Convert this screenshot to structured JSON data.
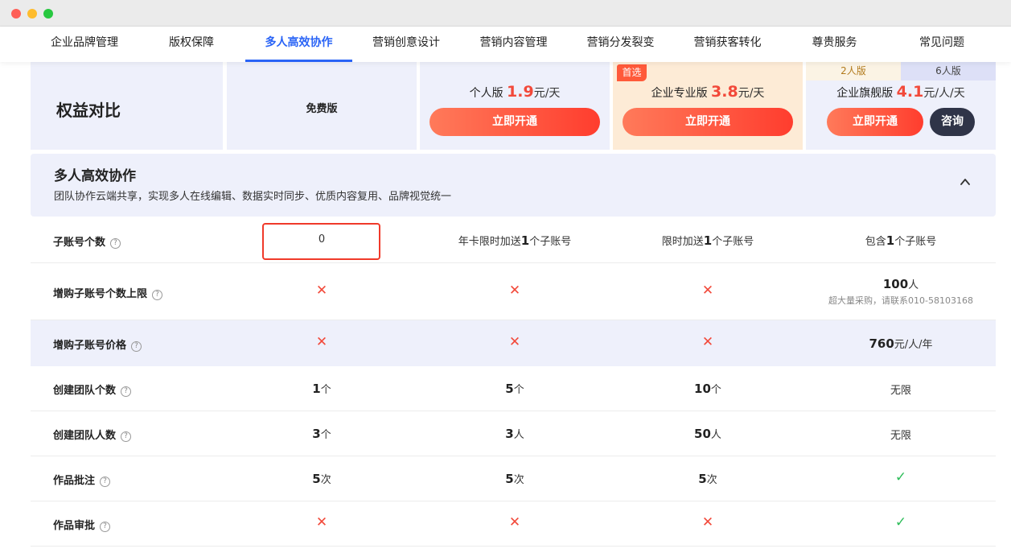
{
  "nav": {
    "tabs": [
      {
        "label": "企业品牌管理"
      },
      {
        "label": "版权保障"
      },
      {
        "label": "多人高效协作"
      },
      {
        "label": "营销创意设计"
      },
      {
        "label": "营销内容管理"
      },
      {
        "label": "营销分发裂变"
      },
      {
        "label": "营销获客转化"
      },
      {
        "label": "尊贵服务"
      },
      {
        "label": "常见问题"
      }
    ],
    "active": "多人高效协作"
  },
  "header": {
    "rights_title": "权益对比",
    "free": {
      "name": "免费版"
    },
    "personal": {
      "name": "个人版",
      "price": "1.9",
      "unit": "元/天",
      "button": "立即开通"
    },
    "pro": {
      "badge": "首选",
      "name": "企业专业版",
      "price": "3.8",
      "unit": "元/天",
      "button": "立即开通"
    },
    "flagship": {
      "versions": [
        "2人版",
        "6人版"
      ],
      "name": "企业旗舰版",
      "price": "4.1",
      "unit": "元/人/天",
      "button": "立即开通",
      "consult": "咨询"
    }
  },
  "section": {
    "title": "多人高效协作",
    "description": "团队协作云端共享，实现多人在线编辑、数据实时同步、优质内容复用、品牌视觉统一"
  },
  "rows": [
    {
      "label": "子账号个数",
      "free": "0",
      "personal": {
        "pre": "年卡限时加送",
        "num": "1",
        "post": "个子账号"
      },
      "pro": {
        "pre": "限时加送",
        "num": "1",
        "post": "个子账号"
      },
      "flagship": {
        "pre": "包含",
        "num": "1",
        "post": "个子账号"
      }
    },
    {
      "label": "增购子账号个数上限",
      "flagship": {
        "num": "100",
        "unit": "人",
        "note": "超大量采购，请联系010-58103168"
      }
    },
    {
      "label": "增购子账号价格",
      "flagship": {
        "num": "760",
        "unit": "元/人/年"
      }
    },
    {
      "label": "创建团队个数",
      "free": {
        "num": "1",
        "unit": "个"
      },
      "personal": {
        "num": "5",
        "unit": "个"
      },
      "pro": {
        "num": "10",
        "unit": "个"
      },
      "flagship": "无限"
    },
    {
      "label": "创建团队人数",
      "free": {
        "num": "3",
        "unit": "个"
      },
      "personal": {
        "num": "3",
        "unit": "人"
      },
      "pro": {
        "num": "50",
        "unit": "人"
      },
      "flagship": "无限"
    },
    {
      "label": "作品批注",
      "free": {
        "num": "5",
        "unit": "次"
      },
      "personal": {
        "num": "5",
        "unit": "次"
      },
      "pro": {
        "num": "5",
        "unit": "次"
      }
    },
    {
      "label": "作品审批"
    }
  ],
  "icons": {
    "help": "?",
    "cross": "✕",
    "check": "✓"
  },
  "colors": {
    "accent_blue": "#2a64f6",
    "price_red": "#f2493a",
    "check_green": "#2ebd5a",
    "panel_bg": "#eef0fb",
    "pro_bg": "#fdebd6"
  }
}
